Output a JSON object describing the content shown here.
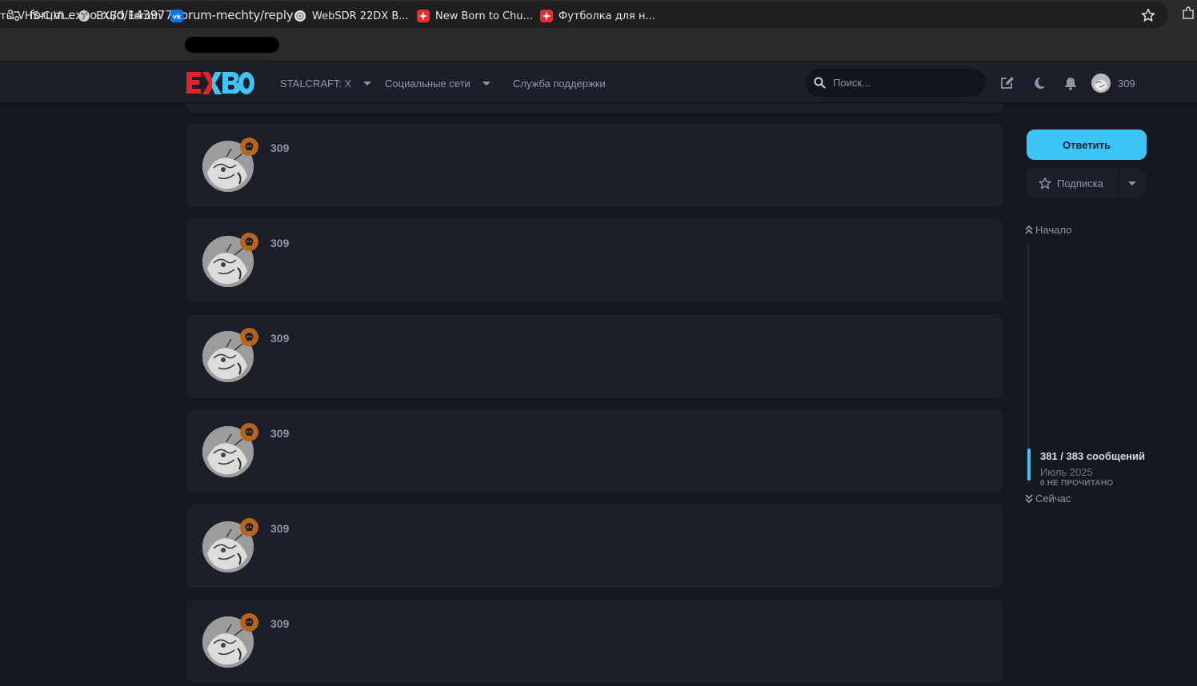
{
  "browser": {
    "url": "forum.exbo.ru/d/143977-forum-mechty/reply",
    "bookmarks": [
      {
        "label": "ты VHS-C,Vi..."
      },
      {
        "label": "EXBO Forum"
      },
      {
        "label": "New Born to Chu..."
      },
      {
        "label": "Футболка для н..."
      },
      {
        "label": "WebSDR 22DX B..."
      }
    ]
  },
  "header": {
    "nav": [
      {
        "label": "STALCRAFT: X"
      },
      {
        "label": "Социальные сети"
      },
      {
        "label": "Служба поддержки"
      }
    ],
    "search_placeholder": "Поиск...",
    "username": "309"
  },
  "posts": [
    {
      "author": "309"
    },
    {
      "author": "309"
    },
    {
      "author": "309"
    },
    {
      "author": "309"
    },
    {
      "author": "309"
    },
    {
      "author": "309"
    }
  ],
  "sidebar": {
    "reply_label": "Ответить",
    "subscribe_label": "Подписка",
    "scrubber": {
      "start_label": "Начало",
      "count": "381 / 383 сообщений",
      "date": "Июль 2025",
      "unread": "0 НЕ ПРОЧИТАНО",
      "now_label": "Сейчас"
    }
  },
  "colors": {
    "accent": "#3ec5f7",
    "background": "#161821",
    "card": "#1c1e29",
    "badge": "#b5651d",
    "logo_red": "#e0242b",
    "logo_blue": "#3ec5f7"
  }
}
